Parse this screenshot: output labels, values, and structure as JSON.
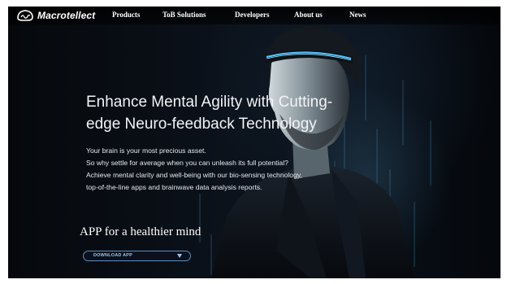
{
  "brand": {
    "logo_text": "Macrotellect",
    "logo_icon": "brain-wave-logo-icon"
  },
  "nav": {
    "items": [
      {
        "label": "Products"
      },
      {
        "label": "ToB Solutions"
      },
      {
        "label": "Developers"
      },
      {
        "label": "About us"
      },
      {
        "label": "News"
      }
    ]
  },
  "hero": {
    "headline_line1": "Enhance Mental Agility with Cutting-",
    "headline_line2": "edge Neuro-feedback Technology",
    "body_lines": [
      "Your brain is your most precious asset.",
      "So why settle for average when you can unleash its full potential?",
      "Achieve mental clarity and well-being with our bio-sensing technology,",
      "top-of-the-line apps and brainwave data analysis reports."
    ],
    "app_heading": "APP for a healthier mind",
    "download_label": "DOWNLOAD APP",
    "download_icon": "chevron-down-icon"
  },
  "colors": {
    "background": "#070a10",
    "headband_glow": "#4fc3ff",
    "download_border": "#5d8fc0",
    "download_text": "#9cc3ea"
  }
}
